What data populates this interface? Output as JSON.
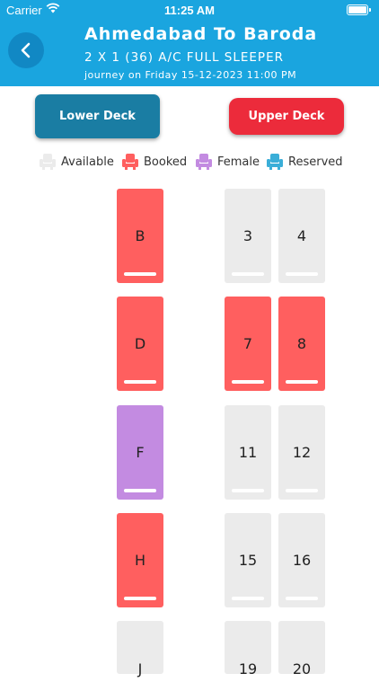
{
  "status_bar": {
    "carrier": "Carrier",
    "time": "11:25 AM"
  },
  "header": {
    "route": "Ahmedabad To Baroda",
    "bus_type": "2 X 1 (36) A/C FULL SLEEPER",
    "journey": "journey on Friday 15-12-2023 11:00 PM"
  },
  "decks": {
    "lower": "Lower Deck",
    "upper": "Upper Deck"
  },
  "legend": {
    "available": "Available",
    "booked": "Booked",
    "female": "Female",
    "reserved": "Reserved"
  },
  "colors": {
    "header": "#1aa5df",
    "available": "#ebebeb",
    "booked": "#ff5f5f",
    "female": "#c38be1",
    "reserved": "#3aaed8",
    "lower_deck_button": "#1a7da3",
    "upper_deck_button": "#ec2b3b"
  },
  "seats": [
    {
      "label": "B",
      "status": "booked"
    },
    {
      "label": "3",
      "status": "available"
    },
    {
      "label": "4",
      "status": "available"
    },
    {
      "label": "D",
      "status": "booked"
    },
    {
      "label": "7",
      "status": "booked"
    },
    {
      "label": "8",
      "status": "booked"
    },
    {
      "label": "F",
      "status": "female"
    },
    {
      "label": "11",
      "status": "available"
    },
    {
      "label": "12",
      "status": "available"
    },
    {
      "label": "H",
      "status": "booked"
    },
    {
      "label": "15",
      "status": "available"
    },
    {
      "label": "16",
      "status": "available"
    },
    {
      "label": "J",
      "status": "available"
    },
    {
      "label": "19",
      "status": "available"
    },
    {
      "label": "20",
      "status": "available"
    }
  ]
}
